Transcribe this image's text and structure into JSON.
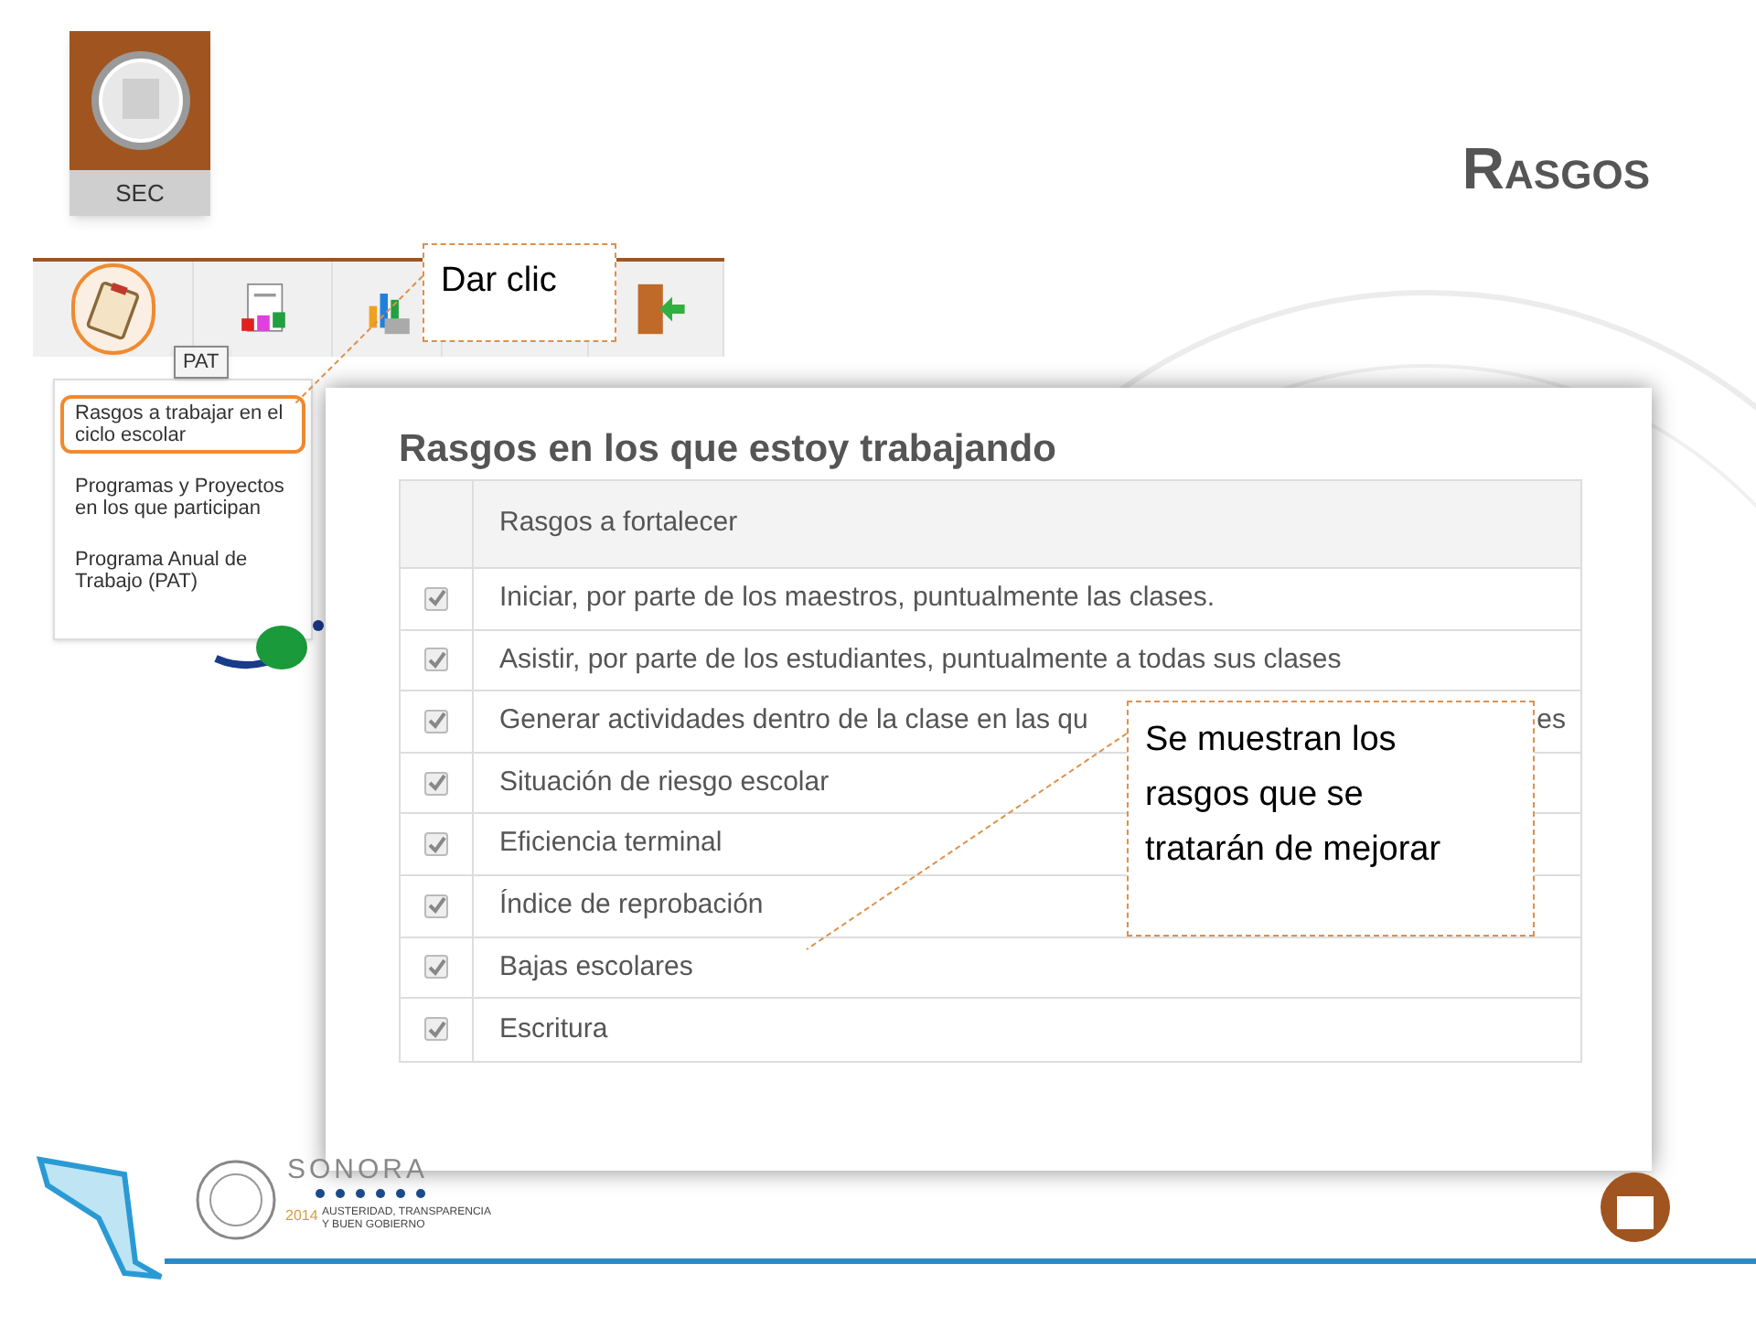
{
  "logo": {
    "label": "SEC"
  },
  "title": "Rasgos",
  "toolbar": {
    "items": [
      {
        "kind": "clipboard",
        "selected": true
      },
      {
        "kind": "report",
        "selected": false
      },
      {
        "kind": "chart",
        "selected": false
      },
      {
        "kind": "blank"
      },
      {
        "kind": "exit",
        "selected": false
      }
    ],
    "tooltip": "PAT"
  },
  "menu": [
    {
      "label": "Rasgos a trabajar en el ciclo escolar",
      "selected": true
    },
    {
      "label": "Programas y Proyectos en los que participan",
      "selected": false
    },
    {
      "label": "Programa Anual de Trabajo (PAT)",
      "selected": false
    }
  ],
  "callouts": [
    {
      "text": "Dar clic"
    },
    {
      "text": "Se muestran los rasgos que se tratarán de mejorar"
    }
  ],
  "panel": {
    "title": "Rasgos en los que estoy trabajando",
    "column": "Rasgos a fortalecer",
    "rows": [
      {
        "text": "Iniciar, por parte de los maestros, puntualmente las clases.",
        "checked": true
      },
      {
        "text": "Asistir, por parte de los estudiantes, puntualmente a todas sus clases",
        "checked": true
      },
      {
        "text": "Generar actividades dentro de la clase en las qu",
        "tail": "es",
        "checked": true
      },
      {
        "text": "Situación de riesgo escolar",
        "checked": true
      },
      {
        "text": "Eficiencia terminal",
        "checked": true
      },
      {
        "text": "Índice de reprobación",
        "checked": true
      },
      {
        "text": "Bajas escolares",
        "checked": true
      },
      {
        "text": "Escritura",
        "checked": true
      }
    ]
  },
  "footer": {
    "brand": "SONORA",
    "year": "2014",
    "motto": [
      "AUSTERIDAD, TRANSPARENCIA",
      "Y BUEN GOBIERNO"
    ]
  }
}
